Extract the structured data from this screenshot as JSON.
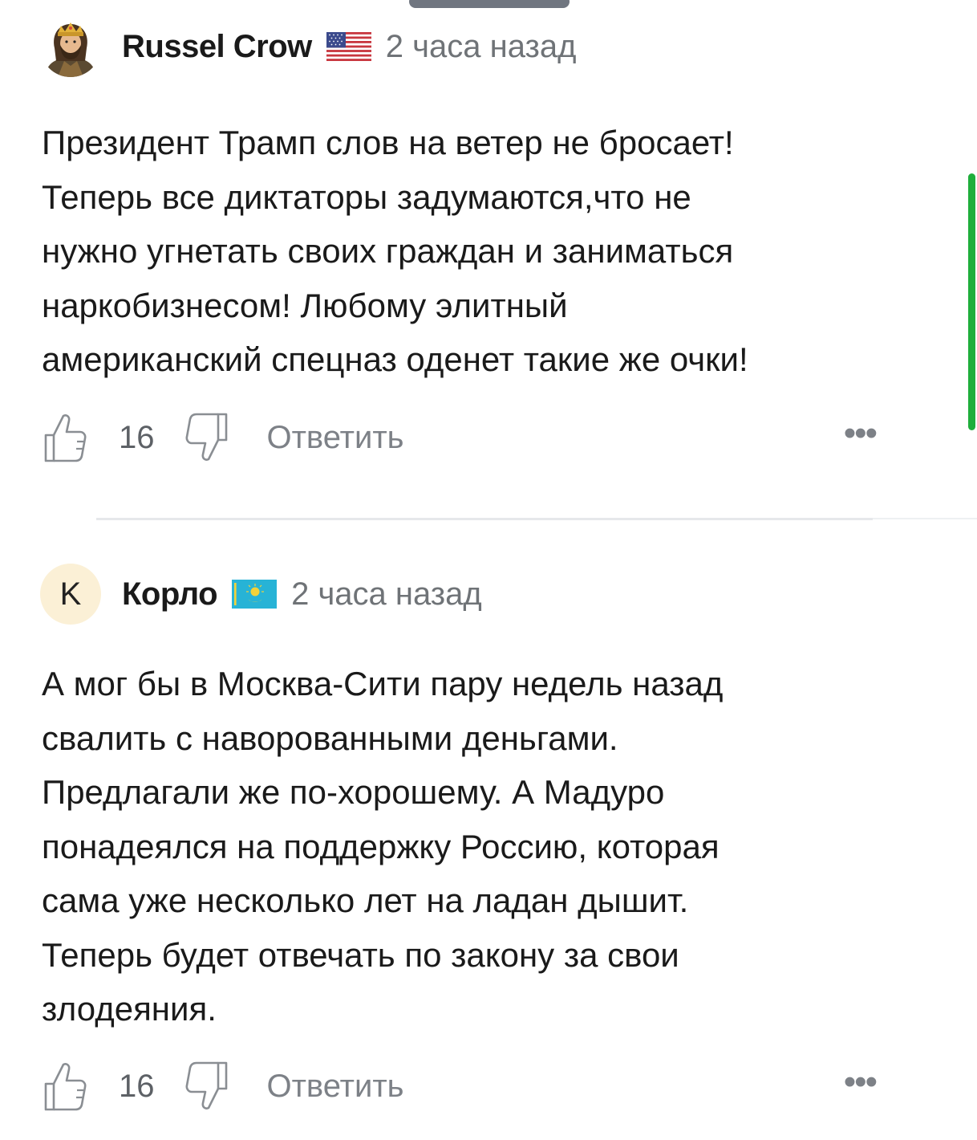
{
  "comments": [
    {
      "author": "Russel Crow",
      "flag": "us-flag",
      "timestamp": "2 часа назад",
      "avatar": "knight-avatar",
      "text": "Президент Трамп слов на ветер не бросает!\nТеперь все диктаторы задумаются,что не\nнужно угнетать своих граждан и заниматься\nнаркобизнесом! Любому элитный\nамериканский спецназ оденет такие же очки!",
      "likes": "16",
      "reply_label": "Ответить",
      "more_label": "•••"
    },
    {
      "author": "Корло",
      "flag": "kz-flag",
      "timestamp": "2 часа назад",
      "avatar_letter": "K",
      "text": "А мог бы в Москва-Сити пару недель назад\nсвалить с наворованными деньгами.\nПредлагали же по-хорошему. А Мадуро\nпонадеялся на поддержку Россию, которая\nсама уже несколько лет на ладан дышит.\nТеперь будет отвечать по закону за свои\nзлодеяния.",
      "likes": "16",
      "reply_label": "Ответить",
      "more_label": "•••"
    }
  ],
  "colors": {
    "accent_green": "#1fae3b",
    "timestamp_gray": "#6f7377",
    "icon_gray": "#8a8e93"
  }
}
